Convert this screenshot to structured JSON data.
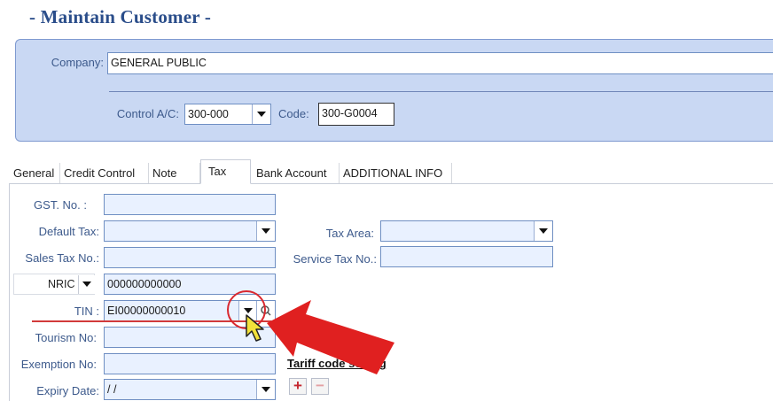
{
  "page": {
    "title": "- Maintain Customer -"
  },
  "header": {
    "company_label": "Company:",
    "company_value": "GENERAL PUBLIC",
    "control_ac_label": "Control A/C:",
    "control_ac_value": "300-000",
    "code_label": "Code:",
    "code_value": "300-G0004"
  },
  "tabs": [
    {
      "label": "General"
    },
    {
      "label": "Credit Control"
    },
    {
      "label": "Note"
    },
    {
      "label": "Tax"
    },
    {
      "label": "Bank Account"
    },
    {
      "label": "ADDITIONAL INFO"
    }
  ],
  "tax_form": {
    "gst_label": "GST. No. :",
    "gst_value": "",
    "default_tax_label": "Default Tax:",
    "default_tax_value": "",
    "tax_area_label": "Tax Area:",
    "tax_area_value": "",
    "sales_tax_label": "Sales Tax No.:",
    "sales_tax_value": "",
    "service_tax_label": "Service Tax No.:",
    "service_tax_value": "",
    "id_type_value": "NRIC",
    "id_number_value": "000000000000",
    "tin_label": "TIN :",
    "tin_value": "EI00000000010",
    "tourism_label": "Tourism No:",
    "tourism_value": "",
    "exemption_label": "Exemption No:",
    "exemption_value": "",
    "expiry_label": "Expiry Date:",
    "expiry_value": " / /",
    "tariff_link": "Tariff code setting",
    "add_symbol": "+",
    "remove_symbol": "−"
  },
  "icons": {
    "dropdown": "chevron-down-icon",
    "search": "search-icon",
    "pointer": "mouse-pointer-icon",
    "annotation": "red-arrow-icon"
  },
  "colors": {
    "title": "#2a4d8a",
    "panel_bg": "#c9d8f3",
    "field_bg": "#e9f1ff",
    "field_border": "#6f8fc3",
    "annotation_red": "#d9282f",
    "add_red": "#c4262e"
  }
}
